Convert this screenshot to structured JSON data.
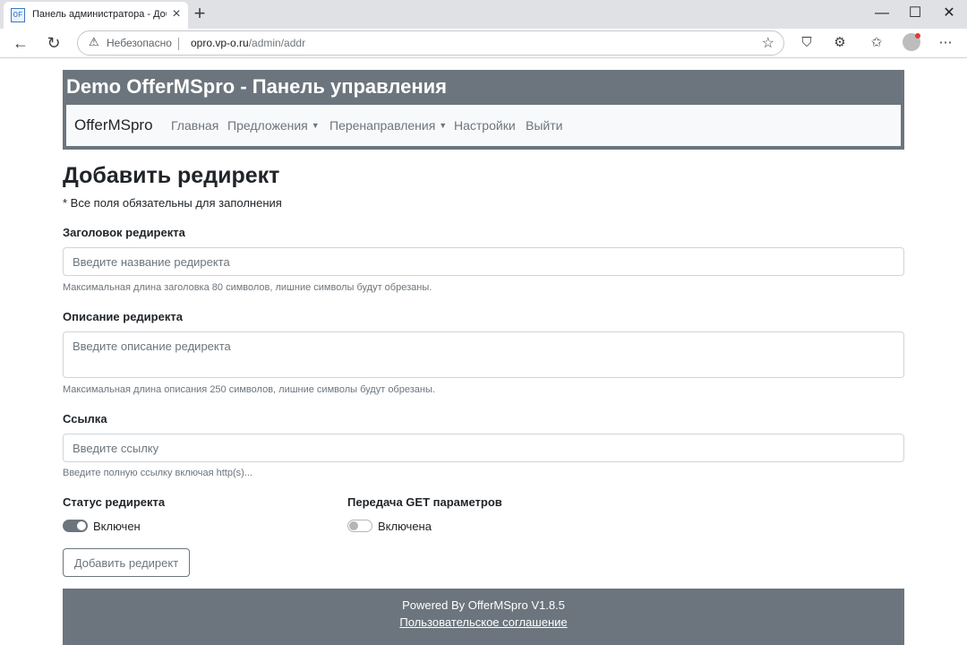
{
  "browser": {
    "tab_title": "Панель администратора - Добавить редирект",
    "favicon_text": "OF",
    "insecure_label": "Небезопасно",
    "url_host": "opro.vp-o.ru",
    "url_path": "/admin/addr"
  },
  "header": {
    "title": "Demo OfferMSpro - Панель управления"
  },
  "navbar": {
    "brand": "OfferMSpro",
    "links": [
      "Главная",
      "Предложения",
      "Перенаправления",
      "Настройки",
      "Выйти"
    ]
  },
  "page": {
    "title": "Добавить редирект",
    "required_note": "* Все поля обязательны для заполнения"
  },
  "form": {
    "title_label": "Заголовок редиректа",
    "title_placeholder": "Введите название редиректа",
    "title_help": "Максимальная длина заголовка 80 символов, лишние символы будут обрезаны.",
    "desc_label": "Описание редиректа",
    "desc_placeholder": "Введите описание редиректа",
    "desc_help": "Максимальная длина описания 250 символов, лишние символы будут обрезаны.",
    "link_label": "Ссылка",
    "link_placeholder": "Введите ссылку",
    "link_help": "Введите полную ссылку включая http(s)...",
    "status_label": "Статус редиректа",
    "status_value_label": "Включен",
    "status_on": true,
    "get_label": "Передача GET параметров",
    "get_value_label": "Включена",
    "get_on": false,
    "submit_label": "Добавить редирект"
  },
  "footer": {
    "powered": "Powered By OfferMSpro V1.8.5",
    "agreement": "Пользовательское соглашение"
  }
}
